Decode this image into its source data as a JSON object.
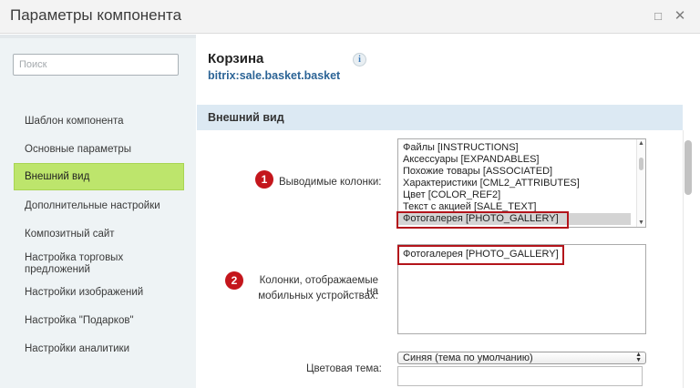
{
  "window": {
    "title": "Параметры компонента",
    "maximize_icon": "□",
    "close_icon": "✕"
  },
  "sidebar": {
    "search_placeholder": "Поиск",
    "items": [
      {
        "label": "Шаблон компонента"
      },
      {
        "label": "Основные параметры"
      },
      {
        "label": "Внешний вид",
        "active": true
      },
      {
        "label": "Дополнительные настройки"
      },
      {
        "label": "Композитный сайт"
      },
      {
        "label": "Настройка торговых предложений"
      },
      {
        "label": "Настройки изображений"
      },
      {
        "label": "Настройка \"Подарков\""
      },
      {
        "label": "Настройки аналитики"
      }
    ]
  },
  "component": {
    "name": "Корзина",
    "code": "bitrix:sale.basket.basket",
    "info_icon": "i"
  },
  "section": {
    "title": "Внешний вид"
  },
  "fields": {
    "columns": {
      "badge": "1",
      "label": "Выводимые колонки:",
      "options": [
        "Файлы [INSTRUCTIONS]",
        "Аксессуары [EXPANDABLES]",
        "Похожие товары [ASSOCIATED]",
        "Характеристики [CML2_ATTRIBUTES]",
        "Цвет [COLOR_REF2]",
        "Текст с акцией [SALE_TEXT]",
        "Фотогалерея [PHOTO_GALLERY]"
      ],
      "selected": "Фотогалерея [PHOTO_GALLERY]"
    },
    "mobile_columns": {
      "badge": "2",
      "label_line1": "Колонки, отображаемые на",
      "label_line2": "мобильных устройствах:",
      "options": [
        "Фотогалерея [PHOTO_GALLERY]"
      ]
    },
    "color_theme": {
      "label": "Цветовая тема:",
      "value": "Синяя (тема по умолчанию)"
    }
  },
  "colors": {
    "active_nav": "#bde56c",
    "section_bar": "#dce9f3",
    "badge": "#c4161c",
    "highlight_border": "#b3141b",
    "code_link": "#2c6496"
  }
}
